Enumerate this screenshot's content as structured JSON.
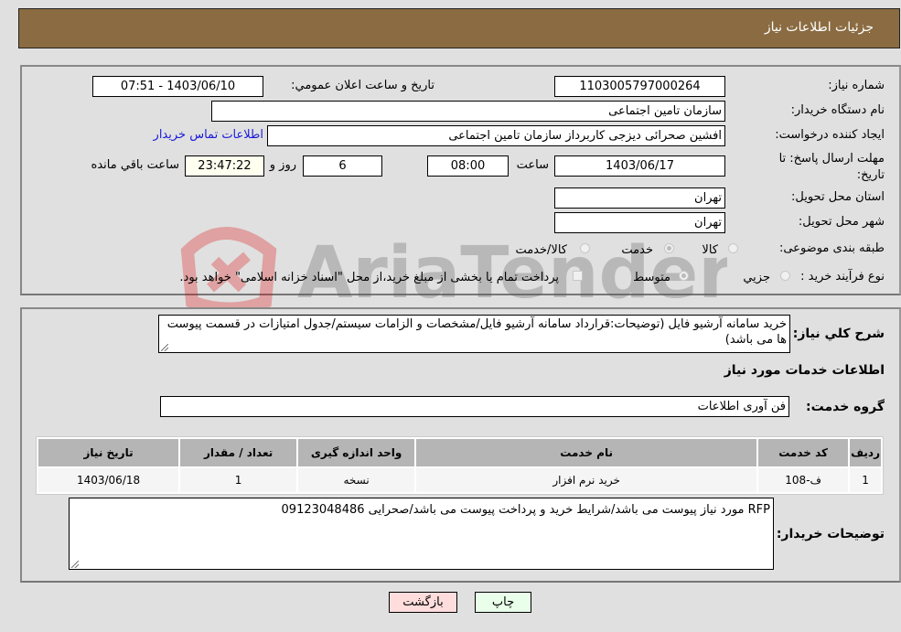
{
  "header": {
    "title": "جزئیات اطلاعات نیاز"
  },
  "form": {
    "need_number_label": "شماره نیاز:",
    "need_number": "1103005797000264",
    "announce_label": "تاریخ و ساعت اعلان عمومي:",
    "announce_value": "1403/06/10 - 07:51",
    "buyer_org_label": "نام دستگاه خریدار:",
    "buyer_org": "سازمان تامین اجتماعی",
    "creator_label": "ایجاد کننده درخواست:",
    "creator": "افشین صحرائی دیزجی کاربرداز سازمان تامین اجتماعی",
    "contact_link": "اطلاعات تماس خریدار",
    "deadline_label": "مهلت ارسال پاسخ: تا تاریخ:",
    "deadline_date": "1403/06/17",
    "time_label": "ساعت",
    "deadline_time": "08:00",
    "days_value": "6",
    "days_label": "روز و",
    "remaining_time": "23:47:22",
    "remaining_label": "ساعت باقي مانده",
    "province_label": "استان محل تحویل:",
    "province": "تهران",
    "city_label": "شهر محل تحویل:",
    "city": "تهران",
    "category_label": "طبقه بندی موضوعی:",
    "category_options": [
      {
        "label": "کالا",
        "selected": false
      },
      {
        "label": "خدمت",
        "selected": true
      },
      {
        "label": "کالا/خدمت",
        "selected": false
      }
    ],
    "process_label": "نوع فرآیند خرید :",
    "process_options": [
      {
        "label": "جزيي",
        "selected": false
      },
      {
        "label": "متوسط",
        "selected": true
      }
    ],
    "treasury_checkbox_label": "پرداخت تمام یا بخشی از مبلغ خرید،از محل \"اسناد خزانه اسلامی\" خواهد بود.",
    "treasury_checked": false
  },
  "details": {
    "description_label": "شرح کلي نیاز:",
    "description": "خرید سامانه آرشیو فایل (توضیحات:قرارداد سامانه آرشیو فایل/مشخصات و الزامات سیستم/جدول امتیازات در قسمت پیوست ها می باشد)",
    "services_heading": "اطلاعات خدمات مورد نیاز",
    "service_group_label": "گروه خدمت:",
    "service_group": "فن آوری اطلاعات",
    "table": {
      "headers": [
        "ردیف",
        "کد خدمت",
        "نام خدمت",
        "واحد اندازه گیری",
        "تعداد / مقدار",
        "تاریخ نیاز"
      ],
      "rows": [
        [
          "1",
          "ف-108",
          "خرید نرم افزار",
          "نسخه",
          "1",
          "1403/06/18"
        ]
      ]
    },
    "buyer_notes_label": "توضیحات خریدار:",
    "buyer_notes": "RFP مورد نیاز پیوست می باشد/شرایط خرید و پرداخت پیوست می باشد/صحرایی 09123048486"
  },
  "buttons": {
    "print": "چاپ",
    "back": "بازگشت"
  },
  "colors": {
    "header_bg": "#8b6c42",
    "print_bg": "#eaffea",
    "back_bg": "#ffdddd",
    "link": "#1a1adb"
  }
}
